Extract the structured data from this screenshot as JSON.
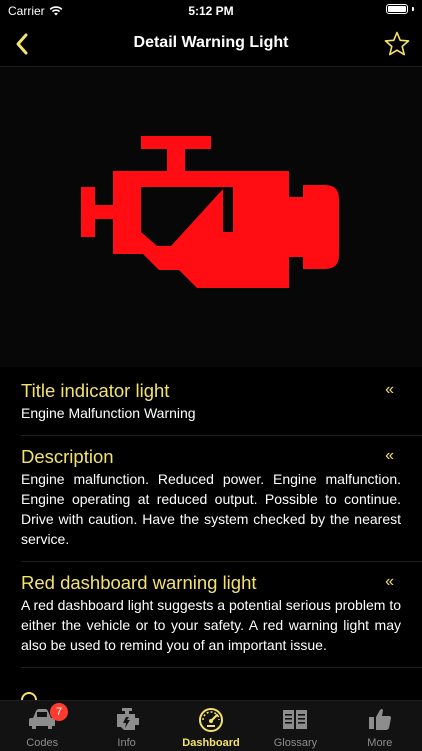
{
  "status_bar": {
    "carrier": "Carrier",
    "time": "5:12 PM"
  },
  "nav": {
    "title": "Detail Warning Light",
    "back_icon": "chevron-left-icon",
    "favorite_icon": "star-outline-icon"
  },
  "warning_light": {
    "icon": "check-engine-icon",
    "color": "#ff0d12"
  },
  "sections": [
    {
      "title": "Title indicator light",
      "toggle": "«",
      "text": "Engine Malfunction Warning"
    },
    {
      "title": "Description",
      "toggle": "«",
      "text": "Engine malfunction. Reduced power. Engine malfunction. Engine operating at reduced output. Possible to continue. Drive with caution. Have the system checked by the nearest service."
    },
    {
      "title": "Red dashboard warning light",
      "toggle": "«",
      "text": "A red dashboard light suggests a potential serious problem to either the vehicle or to your safety. A red warning light may also be used to remind you of an important issue."
    }
  ],
  "tabs": [
    {
      "label": "Codes",
      "icon": "car-icon",
      "badge": "7"
    },
    {
      "label": "Info",
      "icon": "engine-info-icon"
    },
    {
      "label": "Dashboard",
      "icon": "speedometer-icon"
    },
    {
      "label": "Glossary",
      "icon": "book-icon"
    },
    {
      "label": "More",
      "icon": "thumbs-up-icon"
    }
  ],
  "colors": {
    "accent": "#f4e26d",
    "background": "#000000",
    "tab_inactive": "#8d8d8d",
    "badge": "#ff3b30"
  }
}
